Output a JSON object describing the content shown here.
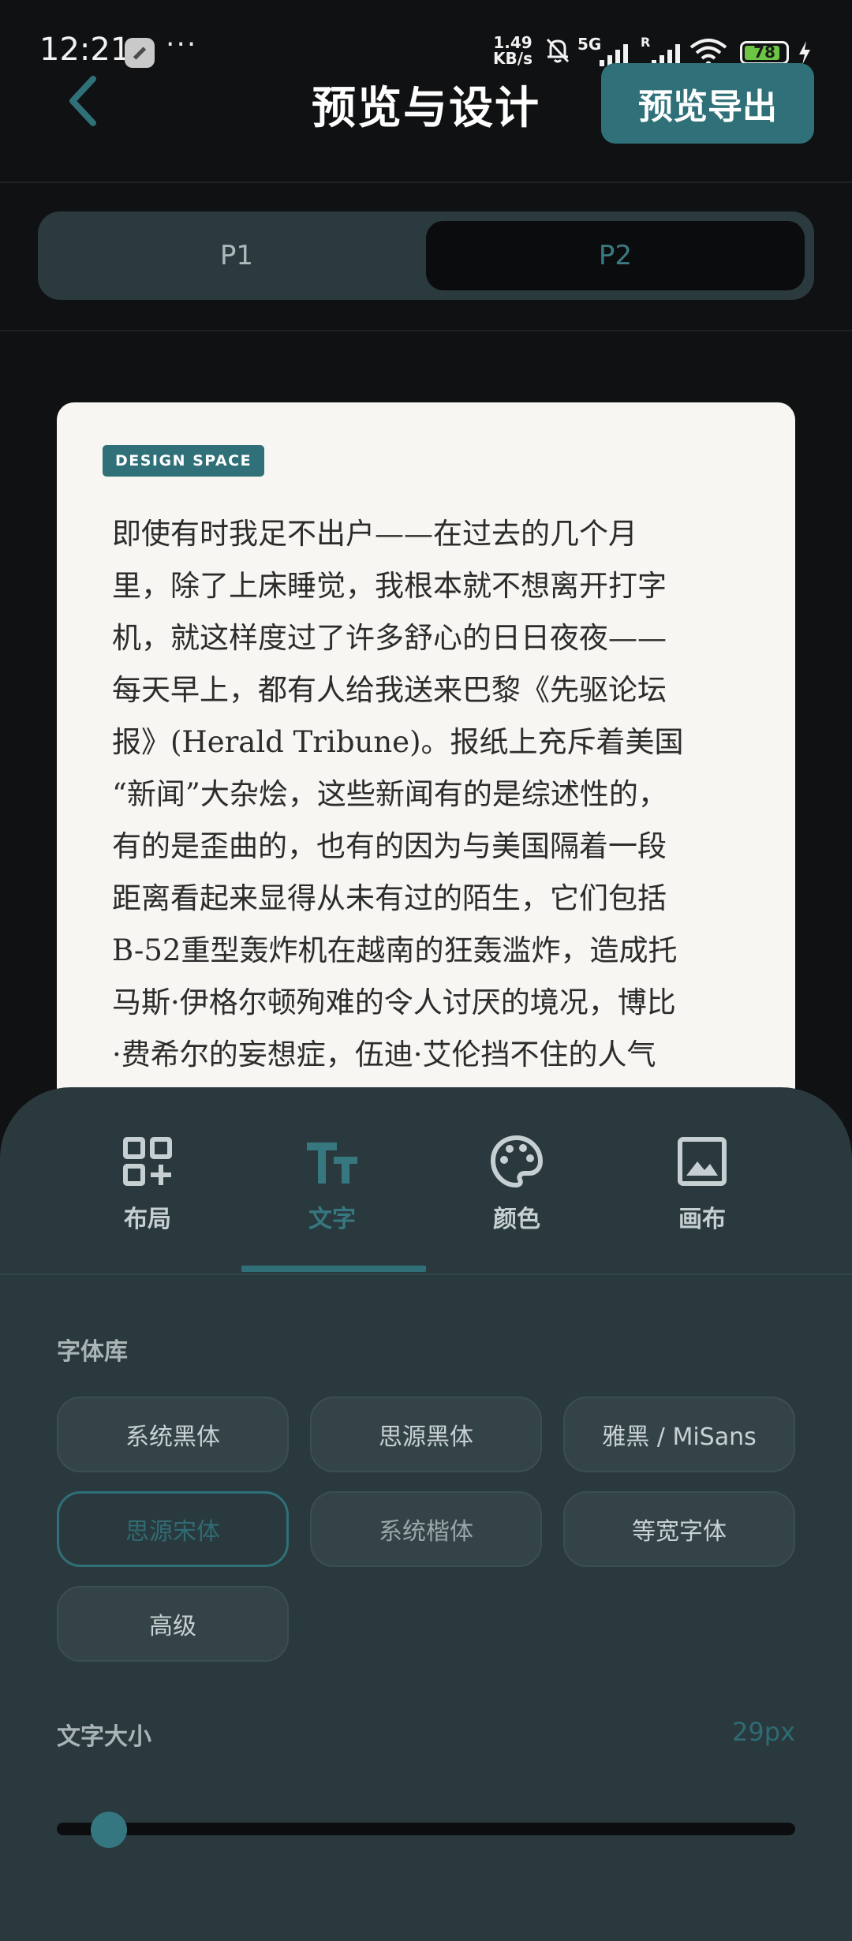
{
  "status_bar": {
    "time": "12:21",
    "more": "···",
    "speed_value": "1.49",
    "speed_unit": "KB/s",
    "network": "5G",
    "roaming": "R",
    "battery": "78"
  },
  "header": {
    "title": "预览与设计",
    "export_label": "预览导出"
  },
  "page_switch": {
    "tabs": [
      "P1",
      "P2"
    ],
    "selected": "P2"
  },
  "preview": {
    "badge": "DESIGN SPACE",
    "lines": [
      "即使有时我足不出户——在过去的几个月",
      "里，除了上床睡觉，我根本就不想离开打字",
      "机，就这样度过了许多舒心的日日夜夜——",
      "每天早上，都有人给我送来巴黎《先驱论坛",
      "报》(Herald Tribune)。报纸上充斥着美国",
      "“新闻”大杂烩，这些新闻有的是综述性的，",
      "有的是歪曲的，也有的因为与美国隔着一段",
      "距离看起来显得从未有过的陌生，它们包括",
      "B-52重型轰炸机在越南的狂轰滥炸，造成托",
      "马斯·伊格尔顿殉难的令人讨厌的境况，博比",
      "·费希尔的妄想症，伍迪·艾伦挡不住的人气"
    ]
  },
  "toolbar": {
    "tabs": [
      {
        "label": "布局",
        "icon": "layout-grid-icon"
      },
      {
        "label": "文字",
        "icon": "text-format-icon"
      },
      {
        "label": "颜色",
        "icon": "palette-icon"
      },
      {
        "label": "画布",
        "icon": "image-icon"
      }
    ],
    "active": "文字"
  },
  "font_library": {
    "label": "字体库",
    "options": [
      "系统黑体",
      "思源黑体",
      "雅黑 / MiSans",
      "思源宋体",
      "系统楷体",
      "等宽字体",
      "高级"
    ],
    "selected": "思源宋体"
  },
  "font_size": {
    "label": "文字大小",
    "value": "29px",
    "slider_fraction": 0.07
  },
  "colors": {
    "accent": "#2f7079",
    "background": "#101112",
    "sheet": "#2a393d",
    "card": "#f7f6f2"
  }
}
